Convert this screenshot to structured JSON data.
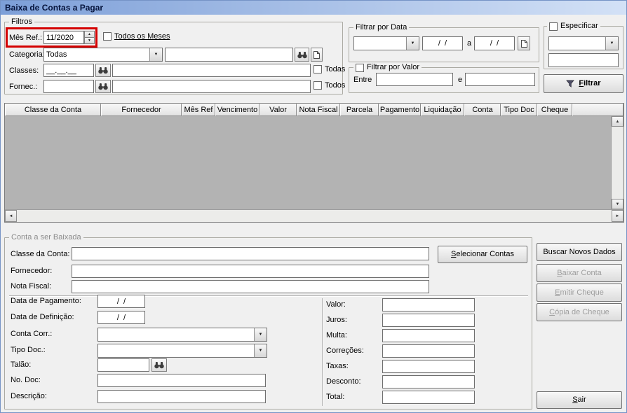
{
  "window": {
    "title": "Baixa de Contas a Pagar"
  },
  "colors": {
    "annotation_red": "#d40000",
    "titlebar_start": "#7d9fd8",
    "titlebar_end": "#d3e1f6",
    "grid_empty_bg": "#b3b3b3"
  },
  "icons": {
    "dropdown_arrow": "▼",
    "spinner_up": "▲",
    "spinner_down": "▼",
    "scroll_left": "◄",
    "scroll_right": "►",
    "scroll_up": "▲",
    "scroll_down": "▼"
  },
  "filters": {
    "legend": "Filtros",
    "mes_ref_label": "Mês Ref.:",
    "mes_ref_value": "11/2020",
    "todos_os_meses_label": "Todos os Meses",
    "categoria_label": "Categoria:",
    "categoria_value": "Todas",
    "categoria_search_value": "",
    "classes_label": "Classes:",
    "classes_mask_value": "__.__.__",
    "classes_desc_value": "",
    "classes_todas_label": "Todas",
    "fornec_label": "Fornec.:",
    "fornec_code_value": "",
    "fornec_desc_value": "",
    "fornec_todos_label": "Todos"
  },
  "filtro_data": {
    "legend": "Filtrar por Data",
    "tipo_value": "",
    "date_from_value": "/  /",
    "between_label": "a",
    "date_to_value": "/  /"
  },
  "filtro_valor": {
    "legend": "Filtrar por Valor",
    "entre_label": "Entre",
    "valor_de_value": "",
    "e_label": "e",
    "valor_ate_value": ""
  },
  "especificar": {
    "legend": "Especificar",
    "campo_value": "",
    "texto_value": ""
  },
  "filtrar_button_label": "Filtrar",
  "grid": {
    "columns": [
      "Classe da Conta",
      "Fornecedor",
      "Mês Ref",
      "Vencimento",
      "Valor",
      "Nota Fiscal",
      "Parcela",
      "Pagamento",
      "Liquidação",
      "Conta",
      "Tipo Doc",
      "Cheque"
    ],
    "rows": []
  },
  "conta": {
    "legend": "Conta a ser Baixada",
    "classe_da_conta_label": "Classe da Conta:",
    "classe_da_conta_value": "",
    "selecionar_contas_label": "Selecionar Contas",
    "fornecedor_label": "Fornecedor:",
    "fornecedor_value": "",
    "nota_fiscal_label": "Nota Fiscal:",
    "nota_fiscal_value": "",
    "data_pagamento_label": "Data de Pagamento:",
    "data_pagamento_value": "/  /",
    "data_definicao_label": "Data de Definição:",
    "data_definicao_value": "/  /",
    "conta_corr_label": "Conta Corr.:",
    "conta_corr_value": "",
    "tipo_doc_label": "Tipo Doc.:",
    "tipo_doc_value": "",
    "talao_label": "Talão:",
    "talao_value": "",
    "no_doc_label": "No. Doc:",
    "no_doc_value": "",
    "descricao_label": "Descrição:",
    "descricao_value": "",
    "amount_labels": [
      "Valor:",
      "Juros:",
      "Multa:",
      "Correções:",
      "Taxas:",
      "Desconto:",
      "Total:"
    ],
    "amount_values": [
      "",
      "",
      "",
      "",
      "",
      "",
      ""
    ]
  },
  "actions": {
    "buscar_label": "Buscar Novos Dados",
    "baixar_label": "Baixar Conta",
    "emitir_label": "Emitir Cheque",
    "copia_label": "Cópia de Cheque",
    "sair_label": "Sair"
  }
}
